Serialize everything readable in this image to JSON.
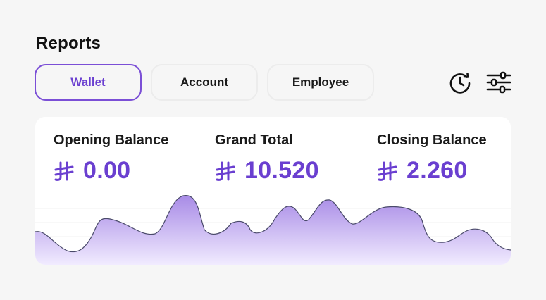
{
  "page": {
    "title": "Reports"
  },
  "tabs": [
    {
      "label": "Wallet",
      "active": true
    },
    {
      "label": "Account",
      "active": false
    },
    {
      "label": "Employee",
      "active": false
    }
  ],
  "toolbar": {
    "history_icon": "history-icon",
    "filter_icon": "filter-sliders-icon"
  },
  "stats": [
    {
      "label": "Opening Balance",
      "currency_icon": "currency-icon",
      "value": "0.00"
    },
    {
      "label": "Grand Total",
      "currency_icon": "currency-icon",
      "value": "10.520"
    },
    {
      "label": "Closing Balance",
      "currency_icon": "currency-icon",
      "value": "2.260"
    }
  ],
  "colors": {
    "accent": "#6a3fd0",
    "area_fill_top": "#a88be6",
    "area_fill_bottom": "#f1ebff"
  }
}
